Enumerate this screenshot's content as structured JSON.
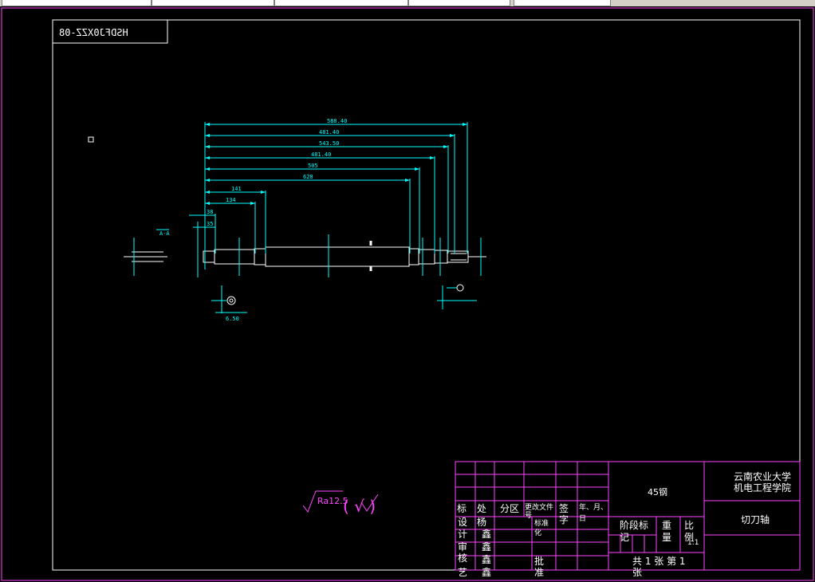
{
  "drawing_number": "HSDFJ0XZZ-08",
  "dimensions": {
    "d1": "588.40",
    "d2": "481.40",
    "d3": "543.50",
    "d4": "481.40",
    "d5": "505",
    "d6": "628",
    "d7": "141",
    "d8": "134",
    "d9": "38",
    "d10": "35",
    "d11": "6.50",
    "section": "A-A"
  },
  "surface_finish": {
    "value": "Ra12.5",
    "paren": "( √ )"
  },
  "title_block": {
    "material": "45钢",
    "school_line1": "云南农业大学",
    "school_line2": "机电工程学院",
    "part_name": "切刀轴",
    "stage_label_1": "阶段标",
    "stage_label_2": "记",
    "weight_label_1": "重",
    "weight_label_2": "量",
    "scale_label_1": "比",
    "scale_label_2": "例",
    "scale_value": "1:1",
    "sheets": "共 1 张  第 1",
    "sheets_2": "张",
    "rev_mark": "标",
    "rev_count": "处",
    "rev_zone": "分区",
    "rev_docno": "更改文件",
    "rev_docno2": "号",
    "rev_sign": "签",
    "rev_sign2": "字",
    "rev_date": "年、月、",
    "rev_date2": "日",
    "design": "设",
    "design2": "计",
    "check": "审",
    "check2": "核",
    "process": "工",
    "process2": "艺",
    "designer": "杨",
    "designer2": "鑫",
    "std": "标准",
    "std2": "化",
    "approve": "批",
    "approve2": "准",
    "name1": "杨",
    "name2": "杨",
    "name3": "杨",
    "name_b": "鑫",
    "name_c": "鑫",
    "name_d": "鑫",
    "mark_b": "记",
    "mark_c": "图",
    "mark_d": "艺",
    "mark_e": "计"
  },
  "colors": {
    "border": "#ff44ff",
    "dimension": "#00ffff",
    "geometry": "#ffffff",
    "background": "#000000"
  }
}
